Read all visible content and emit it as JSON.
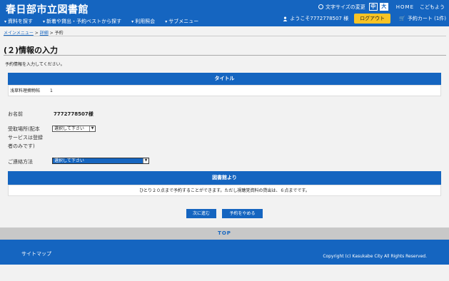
{
  "header": {
    "site_title": "春日部市立図書館",
    "font_size_label": "文字サイズの変更",
    "font_size_medium": "中",
    "font_size_large": "大",
    "home": "HOME",
    "kids": "こどもよう",
    "welcome": "ようこそ7772778507 様",
    "logout": "ログアウト",
    "cart": "予約カート (1件)"
  },
  "nav": {
    "items": [
      {
        "label": "資料を探す"
      },
      {
        "label": "新着や貸出・予約ベストから探す"
      },
      {
        "label": "利用照会"
      },
      {
        "label": "サブメニュー"
      }
    ]
  },
  "breadcrumb": {
    "main_menu": "メインメニュー",
    "sep1": ">",
    "detail": "詳細",
    "sep2": ">",
    "current": "予約"
  },
  "page": {
    "heading": "(２)情報の入力",
    "intro": "予約情報を入力してください。"
  },
  "table": {
    "header": "タイトル",
    "rows": [
      {
        "title": "浅草料理摘物帖",
        "count": "1"
      }
    ]
  },
  "form": {
    "name_label": "お名前",
    "name_value": "7772778507様",
    "pickup_label_1": "受取場所(配本",
    "pickup_label_2": "サービスは登録",
    "pickup_label_3": "者のみです)",
    "pickup_select": "選択して下さい",
    "contact_label": "ご連絡方法",
    "contact_select": "選択して下さい"
  },
  "notice": {
    "header": "図書館より",
    "body": "ひとり２０点まで予約することができます。ただし視聴覚資料の貸出は、６点までです。"
  },
  "buttons": {
    "next": "次に進む",
    "cancel": "予約をやめる"
  },
  "top_link": "TOP",
  "footer": {
    "sitemap": "サイトマップ",
    "copyright": "Copyright (c) Kasukabe City All Rights Reserved."
  },
  "colors": {
    "primary": "#1565c0",
    "accent": "#f7c325",
    "gray_bar": "#c8c8c8"
  }
}
